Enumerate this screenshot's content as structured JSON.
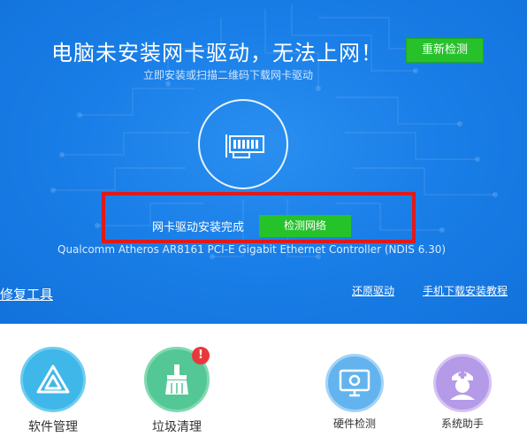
{
  "header": {
    "title": "电脑未安装网卡驱动，无法上网！",
    "subtitle": "立即安装或扫描二维码下载网卡驱动",
    "recheck_label": "重新检测"
  },
  "status": {
    "message": "网卡驱动安装完成",
    "detect_label": "检测网络",
    "device": "Qualcomm Atheros AR8161 PCI-E Gigabit Ethernet Controller (NDIS 6.30)"
  },
  "links": {
    "repair": "修复工具",
    "restore": "还原驱动",
    "mobile": "手机下载安装教程"
  },
  "tools": {
    "software": "软件管理",
    "cleanup": "垃圾清理",
    "cleanup_badge": "!",
    "hardware": "硬件检测",
    "assistant": "系统助手"
  },
  "colors": {
    "hero_blue": "#1a7fe8",
    "button_green": "#26c12b",
    "highlight_red": "#e01a1a"
  }
}
